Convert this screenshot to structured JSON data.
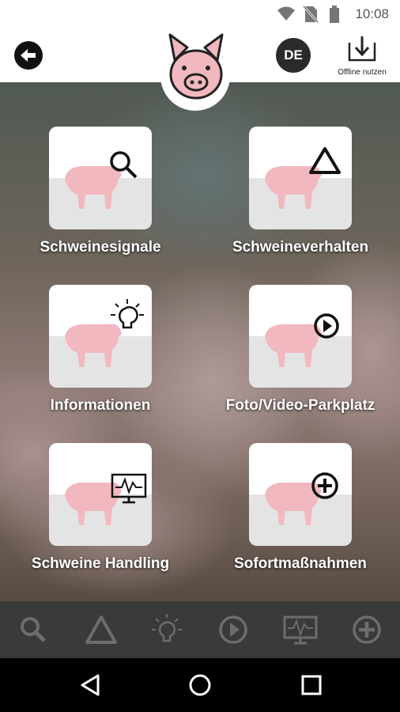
{
  "status_bar": {
    "time": "10:08"
  },
  "header": {
    "language": "DE",
    "offline_label": "Offline nutzen"
  },
  "tiles": [
    {
      "label": "Schweinesignale",
      "icon": "search-icon"
    },
    {
      "label": "Schweineverhalten",
      "icon": "triangle-icon"
    },
    {
      "label": "Informationen",
      "icon": "lightbulb-icon"
    },
    {
      "label": "Foto/Video-Parkplatz",
      "icon": "play-icon"
    },
    {
      "label": "Schweine Handling",
      "icon": "monitor-icon"
    },
    {
      "label": "Sofortmaßnahmen",
      "icon": "plus-icon"
    }
  ],
  "bottom_tabs": [
    "search-icon",
    "triangle-icon",
    "lightbulb-icon",
    "play-icon",
    "monitor-icon",
    "plus-icon"
  ],
  "colors": {
    "pig_pink": "#f2b8bf",
    "tab_icon": "#6d6d6d",
    "bottom_bar": "#3a3a3a"
  }
}
